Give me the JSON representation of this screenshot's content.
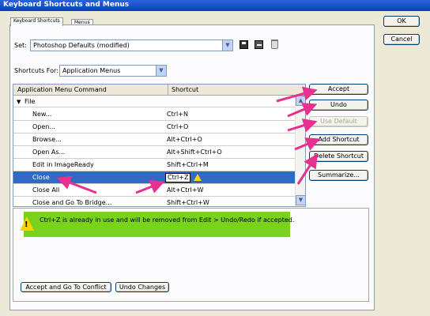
{
  "window": {
    "title": "Keyboard Shortcuts and Menus"
  },
  "tabs": [
    {
      "label": "Keyboard Shortcuts"
    },
    {
      "label": "Menus"
    }
  ],
  "set": {
    "label": "Set:",
    "value": "Photoshop Defaults (modified)"
  },
  "shortcuts_for": {
    "label": "Shortcuts For:",
    "value": "Application Menus"
  },
  "table": {
    "columns": [
      "Application Menu Command",
      "Shortcut"
    ],
    "group": "File",
    "rows": [
      {
        "command": "New...",
        "shortcut": "Ctrl+N"
      },
      {
        "command": "Open...",
        "shortcut": "Ctrl+O"
      },
      {
        "command": "Browse...",
        "shortcut": "Alt+Ctrl+O"
      },
      {
        "command": "Open As...",
        "shortcut": "Alt+Shift+Ctrl+O"
      },
      {
        "command": "Edit in ImageReady",
        "shortcut": "Shift+Ctrl+M"
      },
      {
        "command": "Close",
        "shortcut": "Ctrl+Z"
      },
      {
        "command": "Close All",
        "shortcut": "Alt+Ctrl+W"
      },
      {
        "command": "Close and Go To Bridge...",
        "shortcut": "Shift+Ctrl+W"
      }
    ]
  },
  "buttons": {
    "ok": "OK",
    "cancel": "Cancel",
    "accept": "Accept",
    "undo": "Undo",
    "use_default": "Use Default",
    "add_shortcut": "Add Shortcut",
    "delete_shortcut": "Delete Shortcut",
    "summarize": "Summarize...",
    "accept_conflict": "Accept and Go To Conflict",
    "undo_changes": "Undo Changes"
  },
  "message": "Ctrl+Z is already in use and will be removed from Edit > Undo/Redo if accepted.",
  "colors": {
    "highlight": "#79d21c",
    "arrow": "#e8318e",
    "selection": "#316ac5"
  }
}
